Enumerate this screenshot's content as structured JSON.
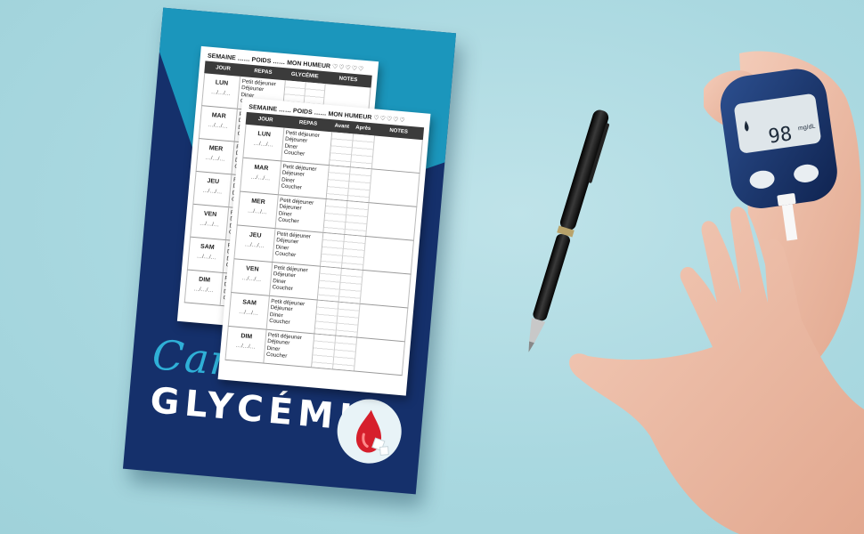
{
  "book": {
    "title_line1": "Carnet de",
    "title_line2": "GLYCÉMIE"
  },
  "sheet": {
    "label_week": "SEMAINE",
    "label_weight": "POIDS",
    "label_mood": "MON HUMEUR",
    "hearts": "♡♡♡♡♡",
    "col_day": "JOUR",
    "col_meal": "REPAS",
    "col_glycemia": "GLYCÉMIE",
    "col_before": "Avant",
    "col_after": "Après",
    "col_notes": "NOTES",
    "date_placeholder": "…/…/…",
    "meals": [
      "Petit déjeuner",
      "Déjeuner",
      "Diner",
      "Coucher"
    ],
    "days": [
      "LUN",
      "MAR",
      "MER",
      "JEU",
      "VEN",
      "SAM",
      "DIM"
    ]
  },
  "meter": {
    "reading": "98",
    "unit": "mg/dL"
  },
  "colors": {
    "background": "#a9d8e0",
    "cover_navy": "#15306b",
    "cover_cyan": "#1b96bc",
    "title_cyan": "#2fb0d7",
    "blood_red": "#d61f2c"
  }
}
